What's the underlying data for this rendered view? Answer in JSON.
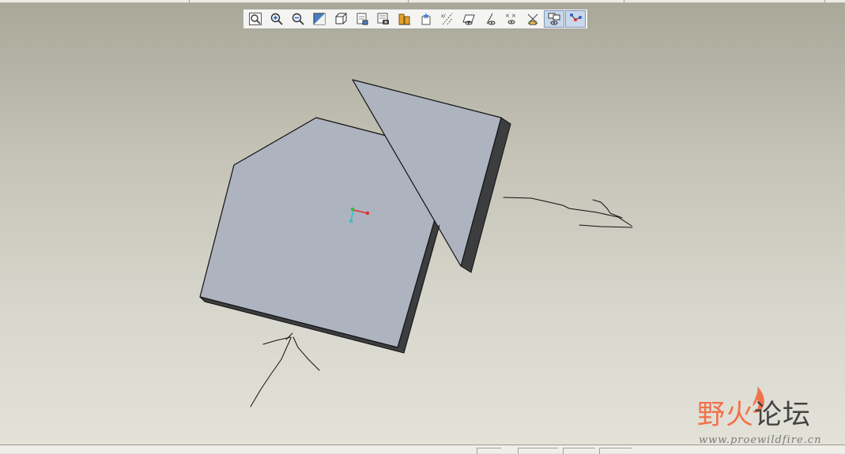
{
  "toolbar": {
    "buttons": [
      {
        "name": "refit-icon",
        "title": "Refit"
      },
      {
        "name": "zoom-in-icon",
        "title": "Zoom In"
      },
      {
        "name": "zoom-out-icon",
        "title": "Zoom Out"
      },
      {
        "name": "repaint-icon",
        "title": "Repaint"
      },
      {
        "name": "orient-icon",
        "title": "Reorient"
      },
      {
        "name": "saved-views-icon",
        "title": "Saved Views"
      },
      {
        "name": "view-manager-icon",
        "title": "View Manager"
      },
      {
        "name": "layers-icon",
        "title": "Layers"
      },
      {
        "name": "appearance-icon",
        "title": "Appearance"
      },
      {
        "name": "datum-axes-icon",
        "title": "Datum Axes"
      },
      {
        "name": "datum-planes-icon",
        "title": "Datum Planes"
      },
      {
        "name": "datum-points-icon",
        "title": "Datum Points"
      },
      {
        "name": "coordinate-systems-icon",
        "title": "Coordinate Systems"
      },
      {
        "name": "annotations-icon",
        "title": "Annotations"
      },
      {
        "name": "spin-center-icon",
        "title": "Spin Center",
        "active": true
      },
      {
        "name": "datum-display-icon",
        "title": "Datum Display",
        "active": true
      }
    ]
  },
  "model": {
    "face_color": "#adb3bf",
    "side_color": "#3c3d3f",
    "edge_color": "#111111"
  },
  "watermark": {
    "title_colored": "野火",
    "title_dark": "论坛",
    "url": "www.proewildfire.cn",
    "accent_color": "#f2724c"
  }
}
